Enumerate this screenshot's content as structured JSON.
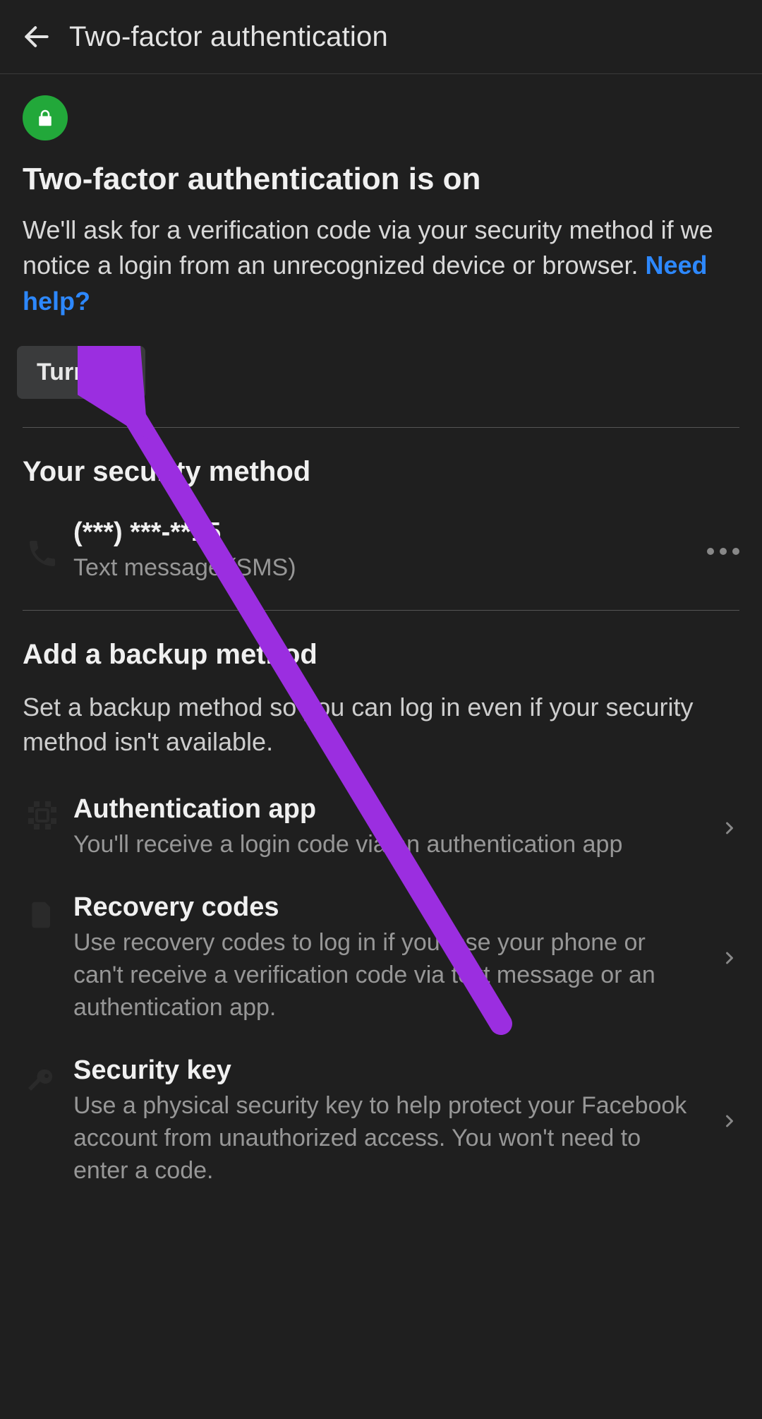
{
  "header": {
    "title": "Two-factor authentication"
  },
  "status": {
    "heading": "Two-factor authentication is on",
    "body": "We'll ask for a verification code via your security method if we notice a login from an unrecognized device or browser. ",
    "help_link": "Need help?",
    "turn_off_label": "Turn off"
  },
  "security_method": {
    "title": "Your security method",
    "phone": "(***) ***-**15",
    "type": "Text message (SMS)"
  },
  "backup": {
    "title": "Add a backup method",
    "desc": "Set a backup method so you can log in even if your security method isn't available.",
    "items": [
      {
        "title": "Authentication app",
        "sub": "You'll receive a login code via an authentication app"
      },
      {
        "title": "Recovery codes",
        "sub": "Use recovery codes to log in if you lose your phone or can't receive a verification code via text message or an authentication app."
      },
      {
        "title": "Security key",
        "sub": "Use a physical security key to help protect your Facebook account from unauthorized access. You won't need to enter a code."
      }
    ]
  }
}
